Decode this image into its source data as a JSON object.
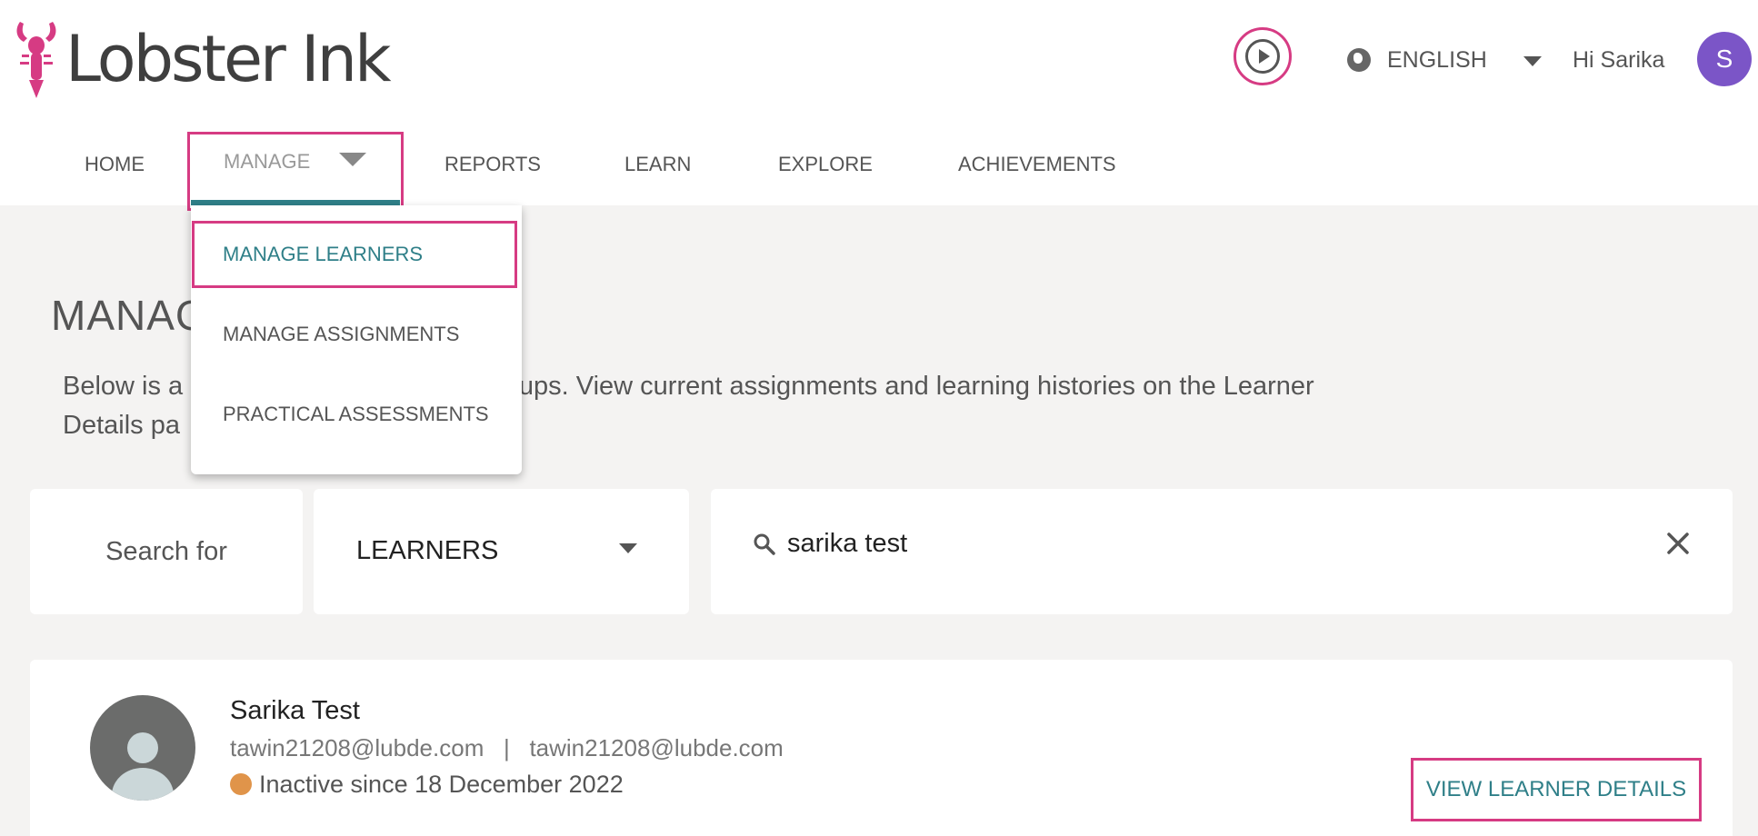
{
  "brand": {
    "name": "Lobster Ink",
    "logo_icon": "lobster-icon",
    "accent": "#d63b83"
  },
  "header": {
    "play_icon": "play-circle-icon",
    "language": "ENGLISH",
    "greeting": "Hi Sarika",
    "avatar_initial": "S",
    "avatar_color": "#7b55c7"
  },
  "nav": {
    "home": "HOME",
    "manage": "MANAGE",
    "reports": "REPORTS",
    "learn": "LEARN",
    "explore": "EXPLORE",
    "achievements": "ACHIEVEMENTS",
    "active_color": "#2f7f88"
  },
  "manage_menu": {
    "items": [
      "MANAGE LEARNERS",
      "MANAGE ASSIGNMENTS",
      "PRACTICAL ASSESSMENTS"
    ],
    "selected": "MANAGE LEARNERS"
  },
  "page": {
    "title": "MANAG",
    "description_line1": "Below is a",
    "description_line1_rest": "zed by learner groups. View current assignments and learning histories on the Learner",
    "description_line2": "Details pa"
  },
  "search": {
    "label": "Search for",
    "type_value": "LEARNERS",
    "query": "sarika test"
  },
  "results": [
    {
      "name": "Sarika Test",
      "emails": "tawin21208@lubde.com   |   tawin21208@lubde.com",
      "status": "Inactive since 18 December 2022",
      "status_color": "#e0944a",
      "action": "VIEW LEARNER DETAILS"
    }
  ]
}
